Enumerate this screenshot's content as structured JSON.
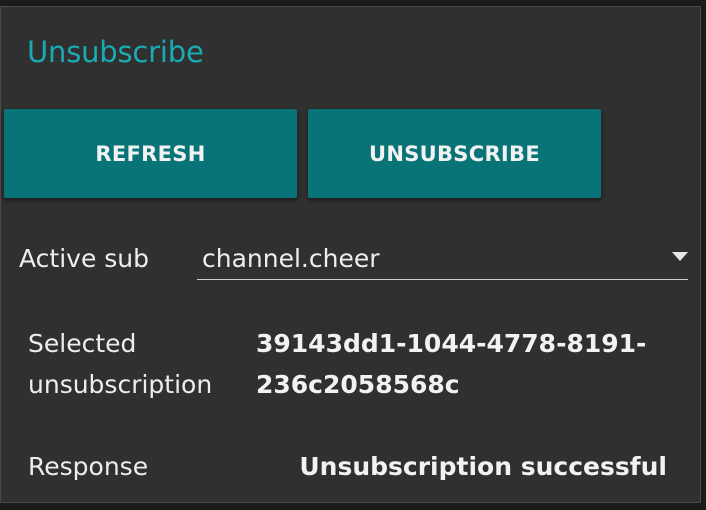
{
  "title": "Unsubscribe",
  "buttons": {
    "refresh_label": "REFRESH",
    "unsubscribe_label": "UNSUBSCRIBE"
  },
  "active_sub": {
    "label": "Active sub",
    "selected_value": "channel.cheer"
  },
  "selected_unsubscription": {
    "label": "Selected unsubscription",
    "value": "39143dd1-1044-4778-8191-236c2058568c"
  },
  "response": {
    "label": "Response",
    "value": "Unsubscription successful"
  },
  "colors": {
    "accent": "#1aaab2",
    "button": "#097477",
    "panel": "#303030",
    "text": "#eeeeee"
  },
  "icons": {
    "dropdown": "caret-down-icon"
  }
}
